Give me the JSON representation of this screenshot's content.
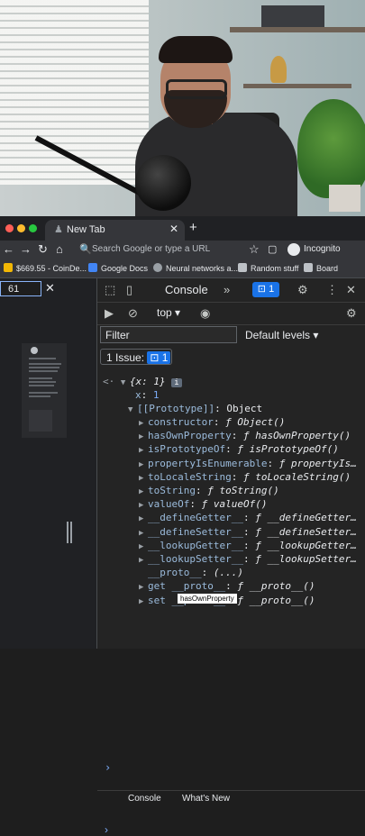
{
  "browser": {
    "tab_title": "New Tab",
    "omnibox_placeholder": "Search Google or type a URL",
    "incognito_label": "Incognito",
    "bookmarks": [
      "$669.55 - CoinDe...",
      "Google Docs",
      "Neural networks a...",
      "Random stuff",
      "Board"
    ]
  },
  "page": {
    "zoom_value": "61"
  },
  "devtools": {
    "active_tab": "Console",
    "issue_badge_count": "1",
    "context": "top",
    "filter_placeholder": "Filter",
    "levels_label": "Default levels",
    "issues_label": "1 Issue:",
    "issues_count": "1",
    "tooltip": "hasOwnProperty",
    "drawer_tabs": [
      "Console",
      "What's New"
    ],
    "console": {
      "object_preview": "{x: 1}",
      "props": [
        {
          "key": "x",
          "val": "1"
        },
        {
          "key": "[[Prototype]]",
          "val": "Object"
        }
      ],
      "proto_members": [
        {
          "name": "constructor",
          "val": "ƒ Object()"
        },
        {
          "name": "hasOwnProperty",
          "val": "ƒ hasOwnProperty()"
        },
        {
          "name": "isPrototypeOf",
          "val": "ƒ isPrototypeOf()"
        },
        {
          "name": "propertyIsEnumerable",
          "val": "ƒ propertyIs…"
        },
        {
          "name": "toLocaleString",
          "val": "ƒ toLocaleString()"
        },
        {
          "name": "toString",
          "val": "ƒ toString()"
        },
        {
          "name": "valueOf",
          "val": "ƒ valueOf()"
        },
        {
          "name": "__defineGetter__",
          "val": "ƒ __defineGetter…"
        },
        {
          "name": "__defineSetter__",
          "val": "ƒ __defineSetter…"
        },
        {
          "name": "__lookupGetter__",
          "val": "ƒ __lookupGetter…"
        },
        {
          "name": "__lookupSetter__",
          "val": "ƒ __lookupSetter…"
        },
        {
          "name": "__proto__",
          "val": "(...)"
        },
        {
          "name": "get __proto__",
          "val": "ƒ __proto__()"
        },
        {
          "name": "set __proto__",
          "val": "ƒ __proto__()"
        }
      ]
    }
  },
  "colors": {
    "accent": "#1a73e8",
    "devtools_bg": "#242424",
    "property_key": "#9bbbdc"
  }
}
